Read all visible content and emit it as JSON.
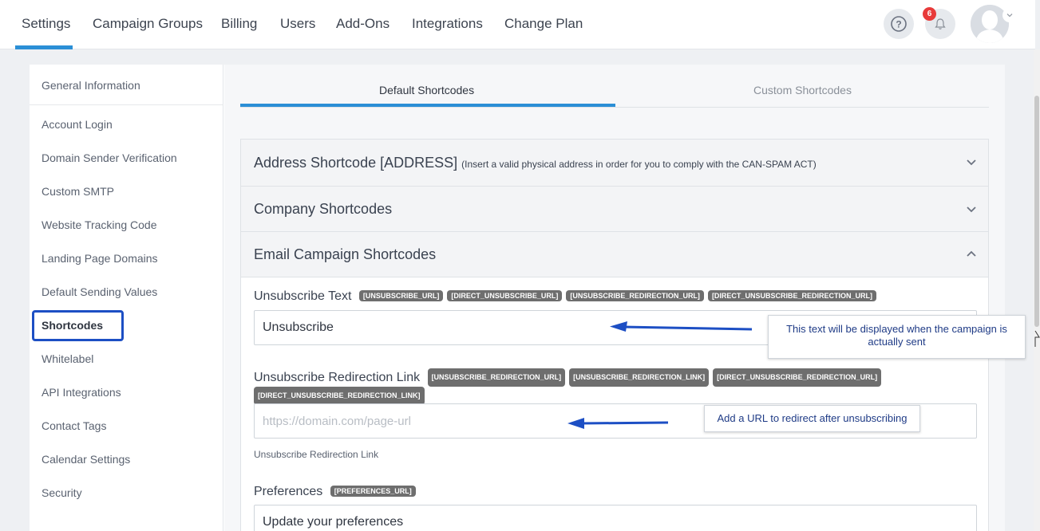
{
  "nav": {
    "items": [
      "Settings",
      "Campaign Groups",
      "Billing",
      "Users",
      "Add-Ons",
      "Integrations",
      "Change Plan"
    ],
    "active": "Settings",
    "notification_count": "6",
    "accent_color": "#2b8fd6"
  },
  "sidebar": {
    "items": [
      "General Information",
      "Account Login",
      "Domain Sender Verification",
      "Custom SMTP",
      "Website Tracking Code",
      "Landing Page Domains",
      "Default Sending Values",
      "Shortcodes",
      "Whitelabel",
      "API Integrations",
      "Contact Tags",
      "Calendar Settings",
      "Security"
    ],
    "active": "Shortcodes"
  },
  "tabs": {
    "default": "Default Shortcodes",
    "custom": "Custom Shortcodes"
  },
  "accordions": {
    "address": {
      "title": "Address Shortcode [ADDRESS]",
      "note": "(Insert a valid physical address in order for you to comply with the CAN-SPAM ACT)"
    },
    "company": {
      "title": "Company Shortcodes"
    },
    "email": {
      "title": "Email Campaign Shortcodes"
    }
  },
  "fields": {
    "unsubscribe_text": {
      "label": "Unsubscribe Text",
      "tags": [
        "[UNSUBSCRIBE_URL]",
        "[DIRECT_UNSUBSCRIBE_URL]",
        "[UNSUBSCRIBE_REDIRECTION_URL]",
        "[DIRECT_UNSUBSCRIBE_REDIRECTION_URL]"
      ],
      "value": "Unsubscribe"
    },
    "unsubscribe_redirect": {
      "label": "Unsubscribe Redirection Link",
      "tags": [
        "[UNSUBSCRIBE_REDIRECTION_URL]",
        "[UNSUBSCRIBE_REDIRECTION_LINK]",
        "[DIRECT_UNSUBSCRIBE_REDIRECTION_URL]",
        "[DIRECT_UNSUBSCRIBE_REDIRECTION_LINK]"
      ],
      "placeholder": "https://domain.com/page-url",
      "help": "Unsubscribe Redirection Link"
    },
    "preferences": {
      "label": "Preferences",
      "tags": [
        "[PREFERENCES_URL]"
      ],
      "value": "Update your preferences"
    }
  },
  "callouts": {
    "unsubscribe_text": "This text will be displayed when the campaign is actually sent",
    "redirect": "Add a URL to redirect after unsubscribing"
  },
  "colors": {
    "annotation_blue": "#1d4fc4",
    "badge_red": "#e83a3a",
    "tag_gray": "#6e6e6e"
  }
}
